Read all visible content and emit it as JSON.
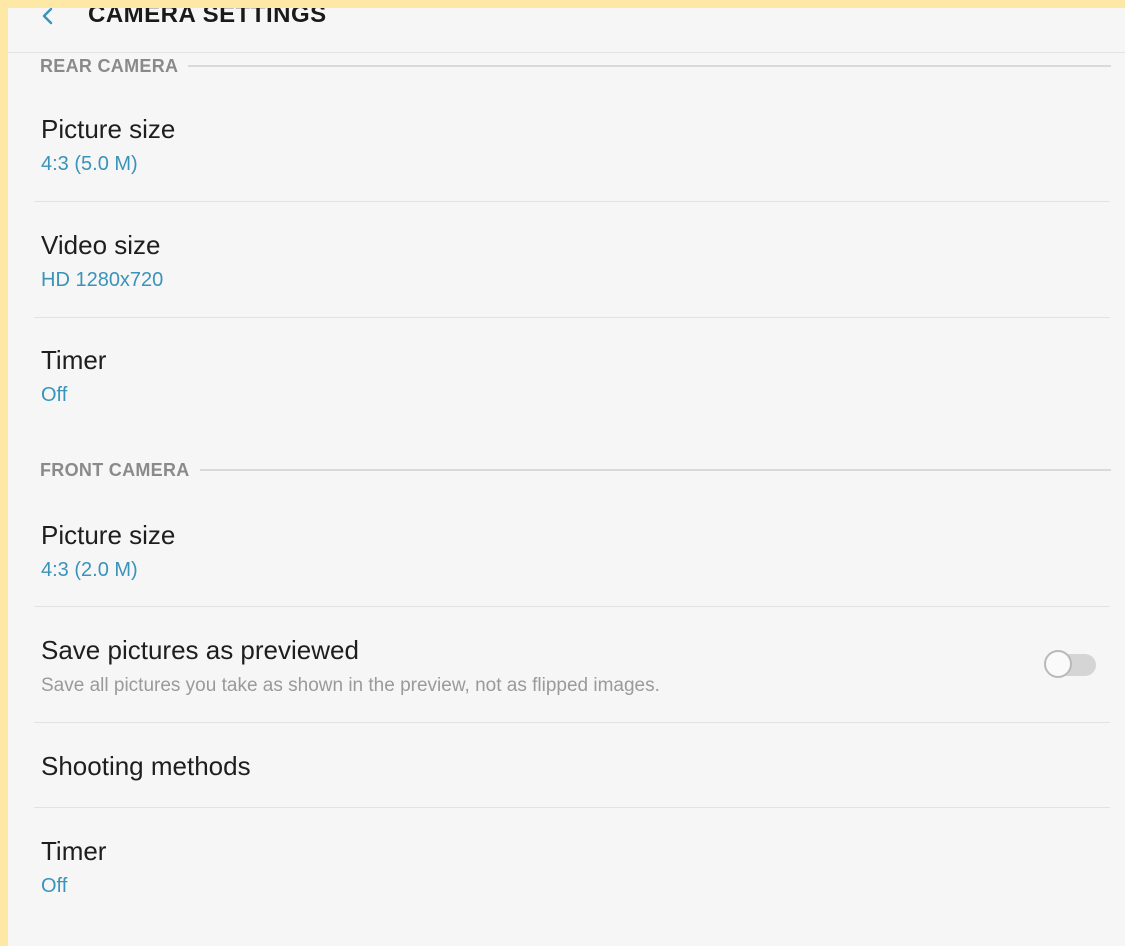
{
  "app": {
    "title": "CAMERA SETTINGS",
    "back_icon": "back-arrow-icon",
    "accent_color": "#3a93b8"
  },
  "sections": [
    {
      "header": "REAR CAMERA",
      "items": [
        {
          "title": "Picture size",
          "value": "4:3 (5.0 M)"
        },
        {
          "title": "Video size",
          "value": "HD 1280x720"
        },
        {
          "title": "Timer",
          "value": "Off"
        }
      ]
    },
    {
      "header": "FRONT CAMERA",
      "items": [
        {
          "title": "Picture size",
          "value": "4:3 (2.0 M)"
        },
        {
          "title": "Save pictures as previewed",
          "description": "Save all pictures you take as shown in the preview, not as flipped images.",
          "toggle": "off"
        },
        {
          "title": "Shooting methods"
        },
        {
          "title": "Timer",
          "value": "Off"
        }
      ]
    }
  ]
}
